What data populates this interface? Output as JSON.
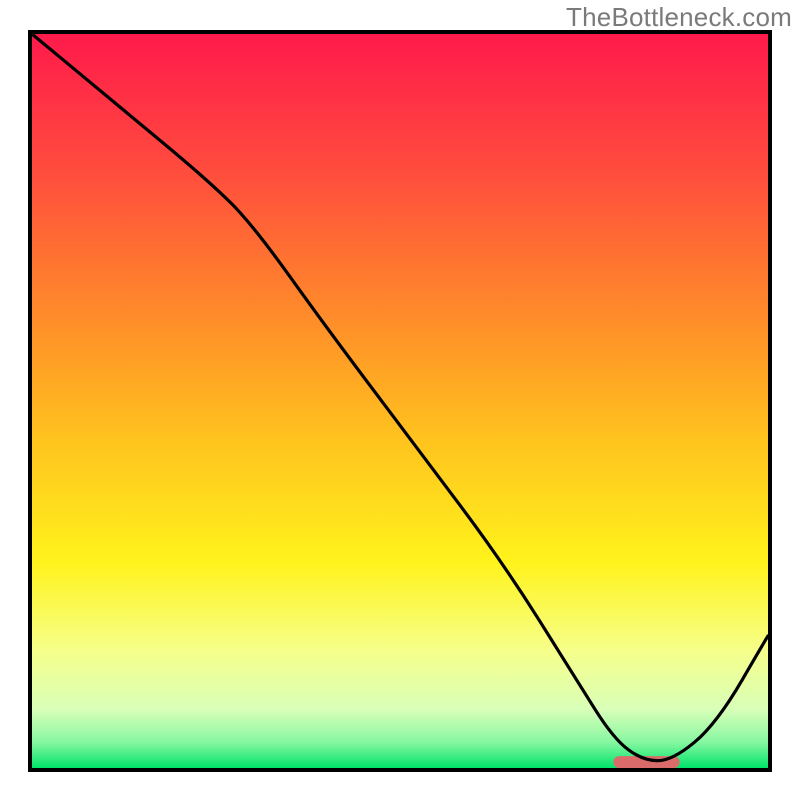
{
  "watermark": "TheBottleneck.com",
  "chart_data": {
    "type": "line",
    "title": "",
    "xlabel": "",
    "ylabel": "",
    "xlim": [
      0,
      100
    ],
    "ylim": [
      0,
      100
    ],
    "grid": false,
    "legend": null,
    "background_gradient": {
      "stops": [
        {
          "offset": 0.0,
          "color": "#ff1a4b"
        },
        {
          "offset": 0.18,
          "color": "#ff4a3e"
        },
        {
          "offset": 0.38,
          "color": "#ff8a2a"
        },
        {
          "offset": 0.55,
          "color": "#ffc21e"
        },
        {
          "offset": 0.72,
          "color": "#fff31c"
        },
        {
          "offset": 0.84,
          "color": "#f6ff8a"
        },
        {
          "offset": 0.92,
          "color": "#d9ffb8"
        },
        {
          "offset": 0.965,
          "color": "#86f7a1"
        },
        {
          "offset": 1.0,
          "color": "#00e36a"
        }
      ]
    },
    "series": [
      {
        "name": "curve",
        "x": [
          0,
          12,
          24,
          30,
          40,
          52,
          64,
          74,
          79,
          83,
          87,
          93,
          100
        ],
        "y": [
          100,
          90,
          80,
          74,
          60,
          44,
          28,
          12,
          4,
          1,
          1,
          6,
          18
        ]
      }
    ],
    "marker": {
      "name": "optimal-range",
      "shape": "rounded-bar",
      "x_start": 79,
      "x_end": 88,
      "y": 0.8,
      "color": "#d96b6b"
    }
  }
}
